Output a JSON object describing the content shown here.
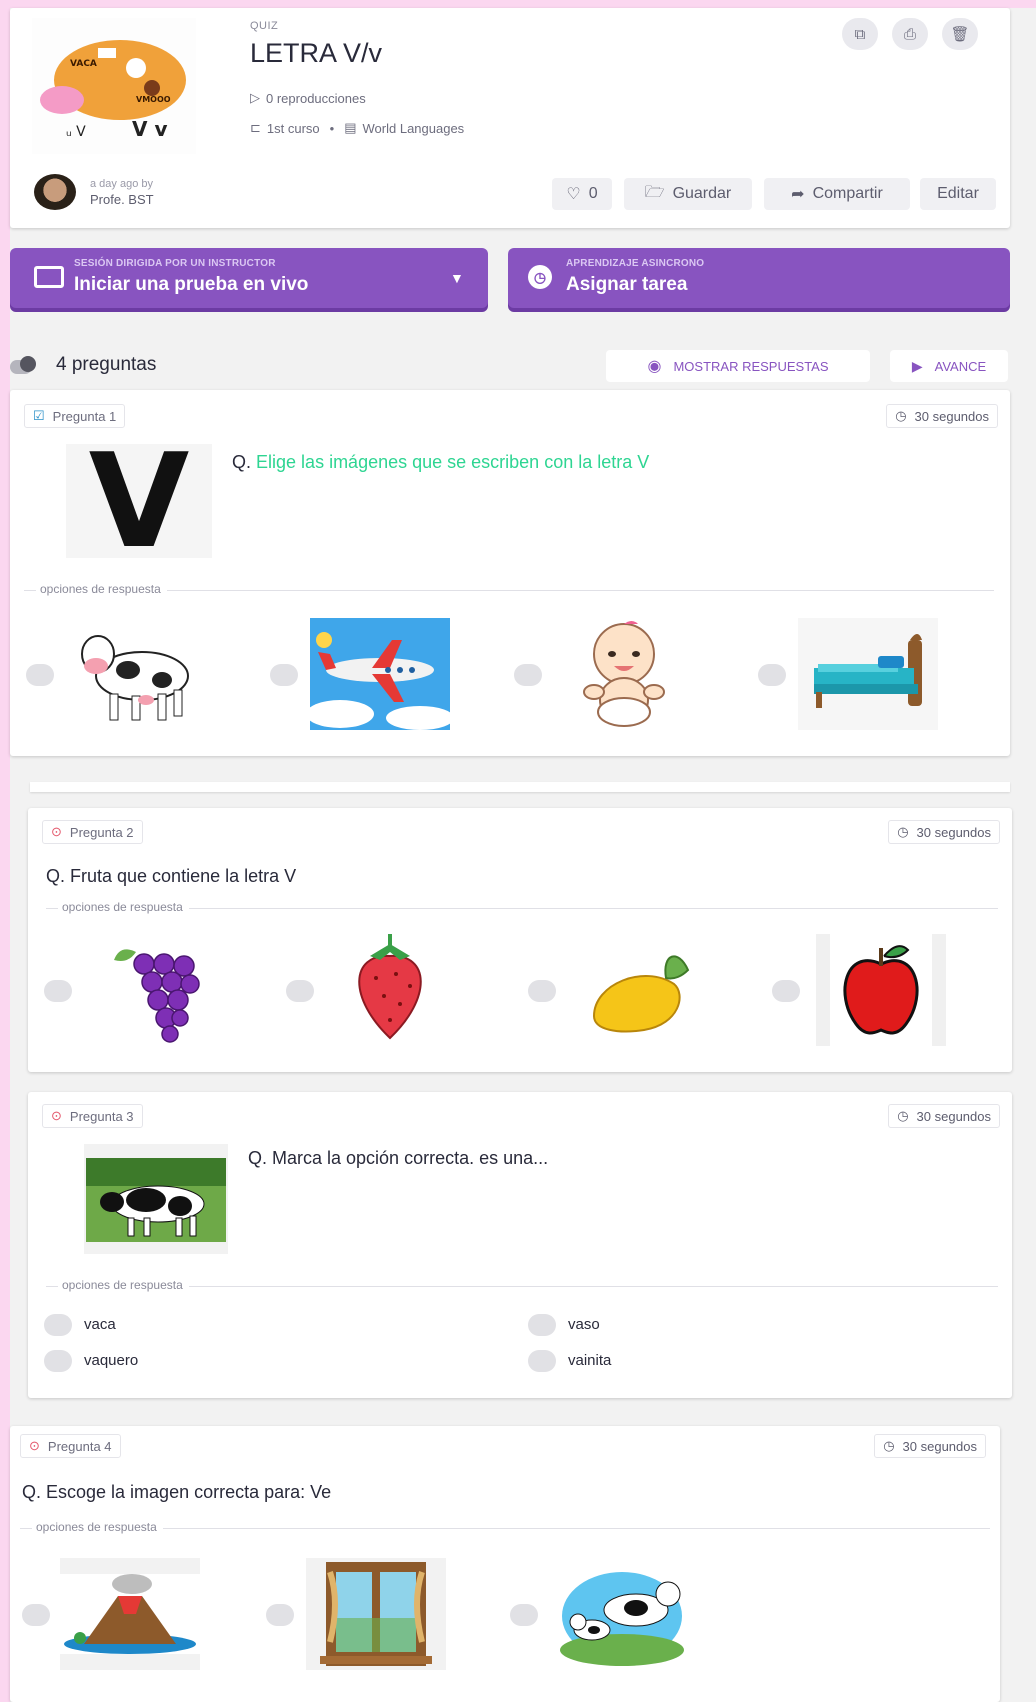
{
  "header": {
    "type_label": "QUIZ",
    "title": "LETRA V/v",
    "plays": "0 reproducciones",
    "grade": "1st curso",
    "subject": "World Languages",
    "author_time": "a day ago by",
    "author_name": "Profe. BST",
    "likes": "0",
    "save_label": "Guardar",
    "share_label": "Compartir",
    "edit_label": "Editar",
    "thumb_text_top": "VACA",
    "thumb_text_mid": "VMOOO",
    "thumb_text_bottom": "V v"
  },
  "actions": {
    "live_sub": "SESIÓN DIRIGIDA POR UN INSTRUCTOR",
    "live_main": "Iniciar una prueba en vivo",
    "async_sub": "APRENDIZAJE ASINCRONO",
    "async_main": "Asignar tarea"
  },
  "toolbar": {
    "count": "4 preguntas",
    "show_answers": "MOSTRAR RESPUESTAS",
    "preview": "AVANCE"
  },
  "questions": [
    {
      "label": "Pregunta 1",
      "time": "30 segundos",
      "prefix": "Q.",
      "text": "Elige las imágenes que se escriben con la letra V",
      "options_label": "opciones de respuesta",
      "image_letter": "V",
      "options": [
        "cow-image",
        "airplane-image",
        "baby-image",
        "bed-image"
      ]
    },
    {
      "label": "Pregunta 2",
      "time": "30 segundos",
      "text": "Q. Fruta que contiene la letra V",
      "options_label": "opciones de respuesta",
      "options": [
        "grapes-image",
        "strawberry-image",
        "mango-image",
        "apple-image"
      ]
    },
    {
      "label": "Pregunta 3",
      "time": "30 segundos",
      "text": "Q. Marca la opción correcta. es una...",
      "options_label": "opciones de respuesta",
      "options": [
        "vaca",
        "vaso",
        "vaquero",
        "vainita"
      ]
    },
    {
      "label": "Pregunta 4",
      "time": "30 segundos",
      "text": "Q. Escoge la imagen correcta para: Ve",
      "options_label": "opciones de respuesta",
      "options": [
        "volcano-image",
        "window-image",
        "cow-calf-image"
      ]
    }
  ],
  "colors": {
    "accent": "#8854c0",
    "question_highlight": "#2ed592",
    "preview": "#8854c0"
  }
}
